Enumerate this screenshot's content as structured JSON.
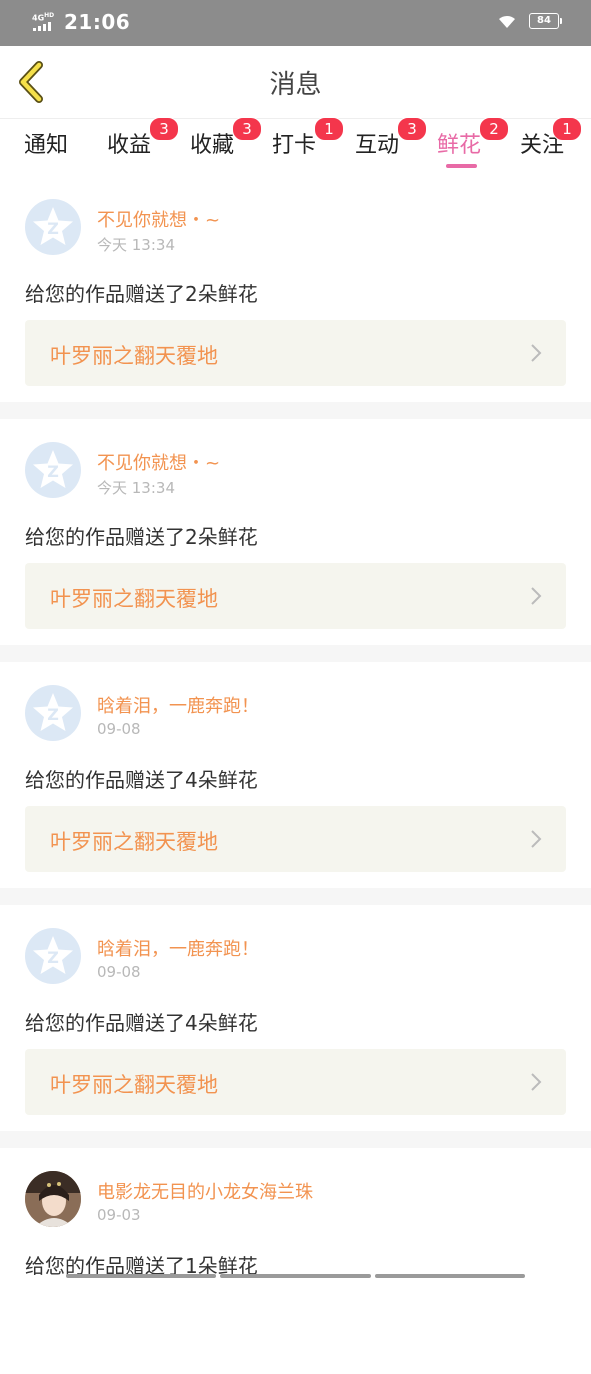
{
  "status_bar": {
    "network": "4G HD",
    "time": "21:06",
    "battery": "84"
  },
  "header": {
    "title": "消息"
  },
  "tabs": [
    {
      "label": "通知",
      "badge": ""
    },
    {
      "label": "收益",
      "badge": "3"
    },
    {
      "label": "收藏",
      "badge": "3"
    },
    {
      "label": "打卡",
      "badge": "1"
    },
    {
      "label": "互动",
      "badge": "3"
    },
    {
      "label": "鲜花",
      "badge": "2",
      "active": true
    },
    {
      "label": "关注",
      "badge": "1"
    }
  ],
  "messages": [
    {
      "user": "不见你就想・~",
      "time": "今天 13:34",
      "text": "给您的作品赠送了2朵鲜花",
      "work": "叶罗丽之翻天覆地",
      "avatar": "default-avatar-icon"
    },
    {
      "user": "不见你就想・~",
      "time": "今天 13:34",
      "text": "给您的作品赠送了2朵鲜花",
      "work": "叶罗丽之翻天覆地",
      "avatar": "default-avatar-icon"
    },
    {
      "user": "晗着泪，一鹿奔跑！",
      "time": "09-08",
      "text": "给您的作品赠送了4朵鲜花",
      "work": "叶罗丽之翻天覆地",
      "avatar": "default-avatar-icon"
    },
    {
      "user": "晗着泪，一鹿奔跑！",
      "time": "09-08",
      "text": "给您的作品赠送了4朵鲜花",
      "work": "叶罗丽之翻天覆地",
      "avatar": "default-avatar-icon"
    },
    {
      "user": "电影龙无目的小龙女海兰珠",
      "time": "09-03",
      "text": "给您的作品赠送了1朵鲜花",
      "work": "",
      "avatar": "photo-avatar"
    }
  ],
  "colors": {
    "accent": "#e86aa6",
    "username": "#f29350",
    "badge": "#f4364c",
    "status_bar": "#8c8c8c",
    "work_card_bg": "#f5f5ee"
  }
}
